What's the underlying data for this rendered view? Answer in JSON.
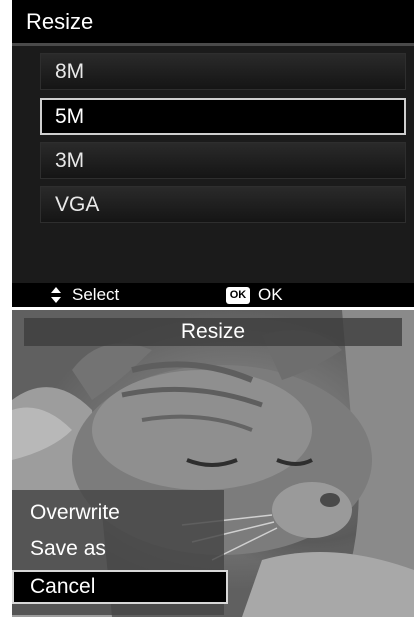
{
  "top": {
    "title": "Resize",
    "options": [
      {
        "label": "8M",
        "selected": false
      },
      {
        "label": "5M",
        "selected": true
      },
      {
        "label": "3M",
        "selected": false
      },
      {
        "label": "VGA",
        "selected": false
      }
    ],
    "footer": {
      "select_icon": "up-down-arrows",
      "select_label": "Select",
      "ok_badge": "OK",
      "ok_label": "OK"
    }
  },
  "bottom": {
    "title": "Resize",
    "options": [
      {
        "label": "Overwrite",
        "selected": false
      },
      {
        "label": "Save as",
        "selected": false
      },
      {
        "label": "Cancel",
        "selected": true
      }
    ],
    "background_photo": "sleeping-cat"
  }
}
